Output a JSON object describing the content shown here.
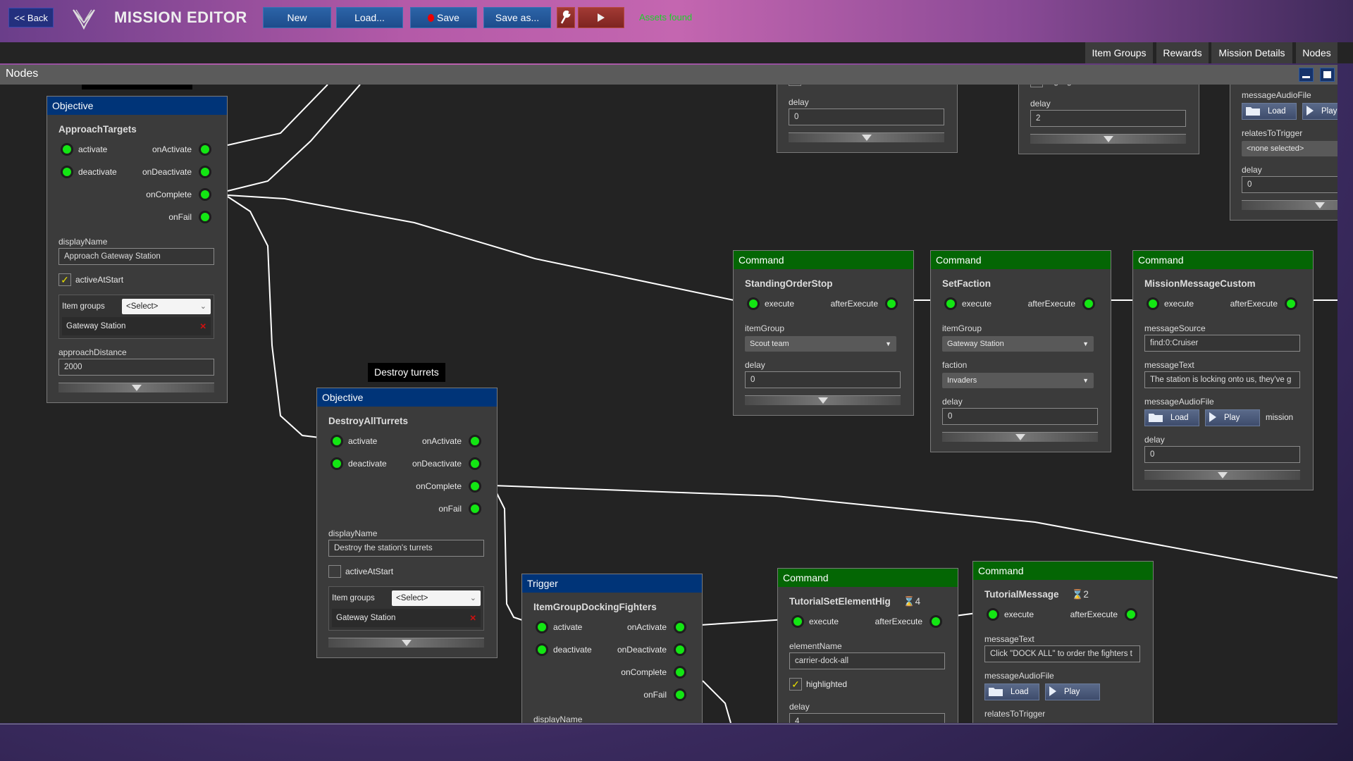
{
  "header": {
    "back_label": "<< Back",
    "title": "MISSION EDITOR",
    "new_label": "New",
    "load_label": "Load...",
    "save_label": "Save",
    "save_as_label": "Save as...",
    "status": "Assets found",
    "status_color": "#1fcf2a"
  },
  "tabs": [
    "Item Groups",
    "Rewards",
    "Mission Details",
    "Nodes"
  ],
  "panel": {
    "title": "Nodes"
  },
  "tooltip": "Destroy turrets",
  "colors": {
    "objective": "#003478",
    "trigger": "#003478",
    "command": "#046604",
    "port": "#13e613"
  },
  "nodes": [
    {
      "type": "Objective",
      "kind": "objective",
      "title": "ApproachTargets",
      "inputs": [
        "activate",
        "deactivate"
      ],
      "outputs": [
        "onActivate",
        "onDeactivate",
        "onComplete",
        "onFail"
      ],
      "fields": [
        {
          "kind": "text",
          "label": "displayName",
          "value": "Approach Gateway Station"
        },
        {
          "kind": "check",
          "label": "activeAtStart",
          "checked": true
        },
        {
          "kind": "itemgroups",
          "label": "Item groups",
          "select": "<Select>",
          "items": [
            "Gateway Station"
          ]
        },
        {
          "kind": "text",
          "label": "approachDistance",
          "value": "2000"
        },
        {
          "kind": "scroll"
        }
      ]
    },
    {
      "type": "Objective",
      "kind": "objective",
      "title": "DestroyAllTurrets",
      "inputs": [
        "activate",
        "deactivate"
      ],
      "outputs": [
        "onActivate",
        "onDeactivate",
        "onComplete",
        "onFail"
      ],
      "fields": [
        {
          "kind": "text",
          "label": "displayName",
          "value": "Destroy the station's turrets"
        },
        {
          "kind": "check",
          "label": "activeAtStart",
          "checked": false
        },
        {
          "kind": "itemgroups",
          "label": "Item groups",
          "select": "<Select>",
          "items": [
            "Gateway Station"
          ]
        },
        {
          "kind": "scroll"
        }
      ]
    },
    {
      "type": "Trigger",
      "kind": "trigger",
      "title": "ItemGroupDockingFighters",
      "inputs": [
        "activate",
        "deactivate"
      ],
      "outputs": [
        "onActivate",
        "onDeactivate",
        "onComplete",
        "onFail"
      ],
      "fields": [
        {
          "kind": "labelonly",
          "label": "displayName"
        }
      ]
    },
    {
      "type": "Command",
      "kind": "command",
      "title": "TutorialSetElementHig",
      "badge": "4",
      "inputs": [
        "execute"
      ],
      "outputs": [
        "afterExecute"
      ],
      "fields": [
        {
          "kind": "text",
          "label": "elementName",
          "value": "carrier-dock-all"
        },
        {
          "kind": "check",
          "label": "highlighted",
          "checked": true
        },
        {
          "kind": "text",
          "label": "delay",
          "value": "4"
        }
      ]
    },
    {
      "type": "Command",
      "kind": "command",
      "title": "TutorialMessage",
      "badge": "2",
      "inputs": [
        "execute"
      ],
      "outputs": [
        "afterExecute"
      ],
      "fields": [
        {
          "kind": "text",
          "label": "messageText",
          "value": "Click \"DOCK ALL\" to order the fighters t"
        },
        {
          "kind": "audio",
          "label": "messageAudioFile",
          "load": "Load",
          "play": "Play"
        },
        {
          "kind": "labelonly",
          "label": "relatesToTrigger"
        }
      ]
    },
    {
      "type": "Command",
      "kind": "command",
      "title": "StandingOrderStop",
      "inputs": [
        "execute"
      ],
      "outputs": [
        "afterExecute"
      ],
      "fields": [
        {
          "kind": "select",
          "label": "itemGroup",
          "value": "Scout team"
        },
        {
          "kind": "text",
          "label": "delay",
          "value": "0"
        },
        {
          "kind": "scroll"
        }
      ]
    },
    {
      "type": "Command",
      "kind": "command",
      "title": "SetFaction",
      "inputs": [
        "execute"
      ],
      "outputs": [
        "afterExecute"
      ],
      "fields": [
        {
          "kind": "select",
          "label": "itemGroup",
          "value": "Gateway Station"
        },
        {
          "kind": "select",
          "label": "faction",
          "value": "Invaders"
        },
        {
          "kind": "text",
          "label": "delay",
          "value": "0"
        },
        {
          "kind": "scroll"
        }
      ]
    },
    {
      "type": "Command",
      "kind": "command",
      "title": "MissionMessageCustom",
      "inputs": [
        "execute"
      ],
      "outputs": [
        "afterExecute"
      ],
      "fields": [
        {
          "kind": "text",
          "label": "messageSource",
          "value": "find:0:Cruiser"
        },
        {
          "kind": "text",
          "label": "messageText",
          "value": "The station is locking onto us, they've g"
        },
        {
          "kind": "audio",
          "label": "messageAudioFile",
          "load": "Load",
          "play": "Play",
          "extra": "mission"
        },
        {
          "kind": "text",
          "label": "delay",
          "value": "0"
        },
        {
          "kind": "scroll"
        }
      ]
    },
    {
      "partial": true,
      "fields": [
        {
          "kind": "check",
          "label": "highlighted",
          "checked": false
        },
        {
          "kind": "text",
          "label": "delay",
          "value": "0"
        },
        {
          "kind": "scroll"
        }
      ]
    },
    {
      "partial": true,
      "fields": [
        {
          "kind": "check",
          "label": "highlighted",
          "checked": true
        },
        {
          "kind": "text",
          "label": "delay",
          "value": "2"
        },
        {
          "kind": "scroll"
        }
      ]
    },
    {
      "partial": true,
      "fields": [
        {
          "kind": "audio",
          "label": "messageAudioFile",
          "load": "Load",
          "play": "Play"
        },
        {
          "kind": "select",
          "label": "relatesToTrigger",
          "value": "<none selected>"
        },
        {
          "kind": "text",
          "label": "delay",
          "value": "0"
        },
        {
          "kind": "scroll"
        }
      ]
    }
  ]
}
